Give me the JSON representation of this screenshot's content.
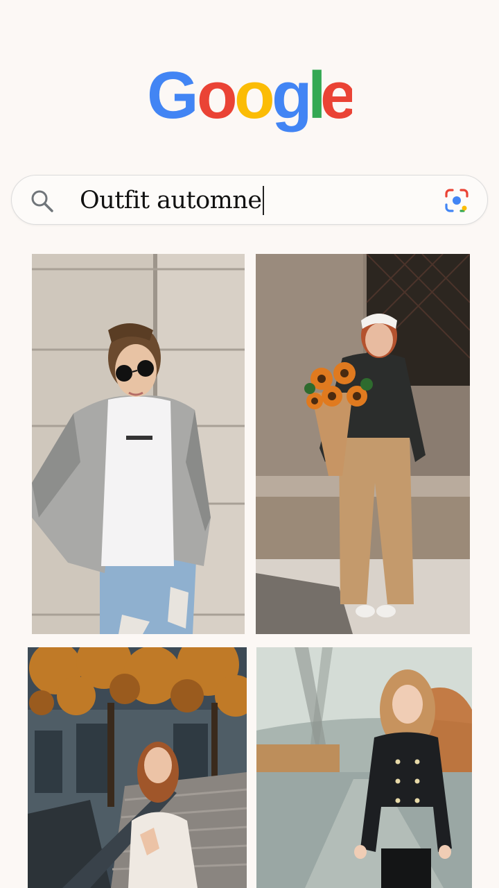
{
  "search": {
    "query": "Outfit automne"
  },
  "icons": {
    "search": "search-icon",
    "lens": "google-lens-icon"
  },
  "colors": {
    "background": "#fcf8f5",
    "google_blue": "#4285F4",
    "google_red": "#EA4335",
    "google_yellow": "#FBBC05",
    "google_green": "#34A853"
  },
  "results": [
    {
      "name": "outfit-photo-denim-jacket"
    },
    {
      "name": "outfit-photo-sunflowers"
    },
    {
      "name": "outfit-photo-autumn-trees"
    },
    {
      "name": "outfit-photo-black-coat"
    }
  ]
}
